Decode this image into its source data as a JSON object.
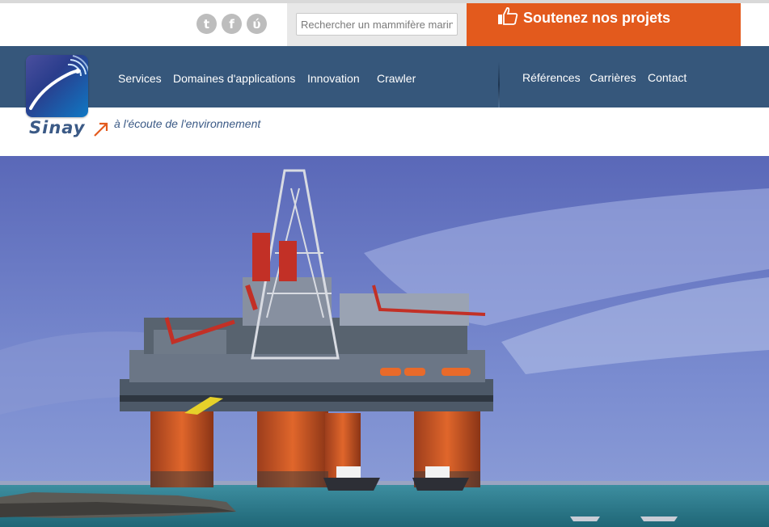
{
  "search": {
    "placeholder": "Rechercher un mammifère marin"
  },
  "social": [
    {
      "icon": "twitter-icon",
      "glyph": "t"
    },
    {
      "icon": "facebook-icon",
      "glyph": "f"
    },
    {
      "icon": "viadeo-icon",
      "glyph": "ύ"
    }
  ],
  "cta": {
    "label": "Soutenez nos projets",
    "icon": "thumbs-up-icon"
  },
  "nav": {
    "items": [
      "Services",
      "Domaines d'applications",
      "Innovation",
      "Crawler"
    ],
    "right_items": [
      "Références",
      "Carrières",
      "Contact"
    ]
  },
  "brand": {
    "name": "Sinay",
    "tagline": "à l'écoute de l'environnement"
  },
  "colors": {
    "nav": "#36577b",
    "cta": "#e35a1d",
    "brand_text": "#3b5a86"
  }
}
